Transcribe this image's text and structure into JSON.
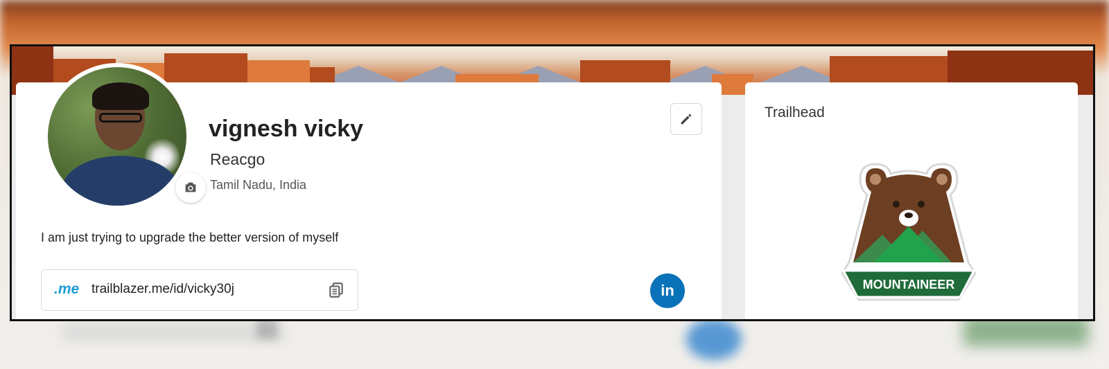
{
  "profile": {
    "name": "vignesh vicky",
    "company": "Reacgo",
    "location": "Tamil Nadu, India",
    "bio": "I am just trying to upgrade the better version of myself",
    "link_prefix": ".me",
    "link_url": "trailblazer.me/id/vicky30j",
    "linkedin_label": "in"
  },
  "side": {
    "title": "Trailhead",
    "badge_label": "MOUNTAINEER"
  },
  "icons": {
    "camera": "camera-icon",
    "edit": "pencil-icon",
    "copy": "copy-icon",
    "linkedin": "linkedin-icon"
  },
  "colors": {
    "linkedin": "#0a72b8",
    "me_logo": "#1b9bd6",
    "badge_green": "#1f6b3a",
    "bear_brown": "#6d3f22"
  }
}
